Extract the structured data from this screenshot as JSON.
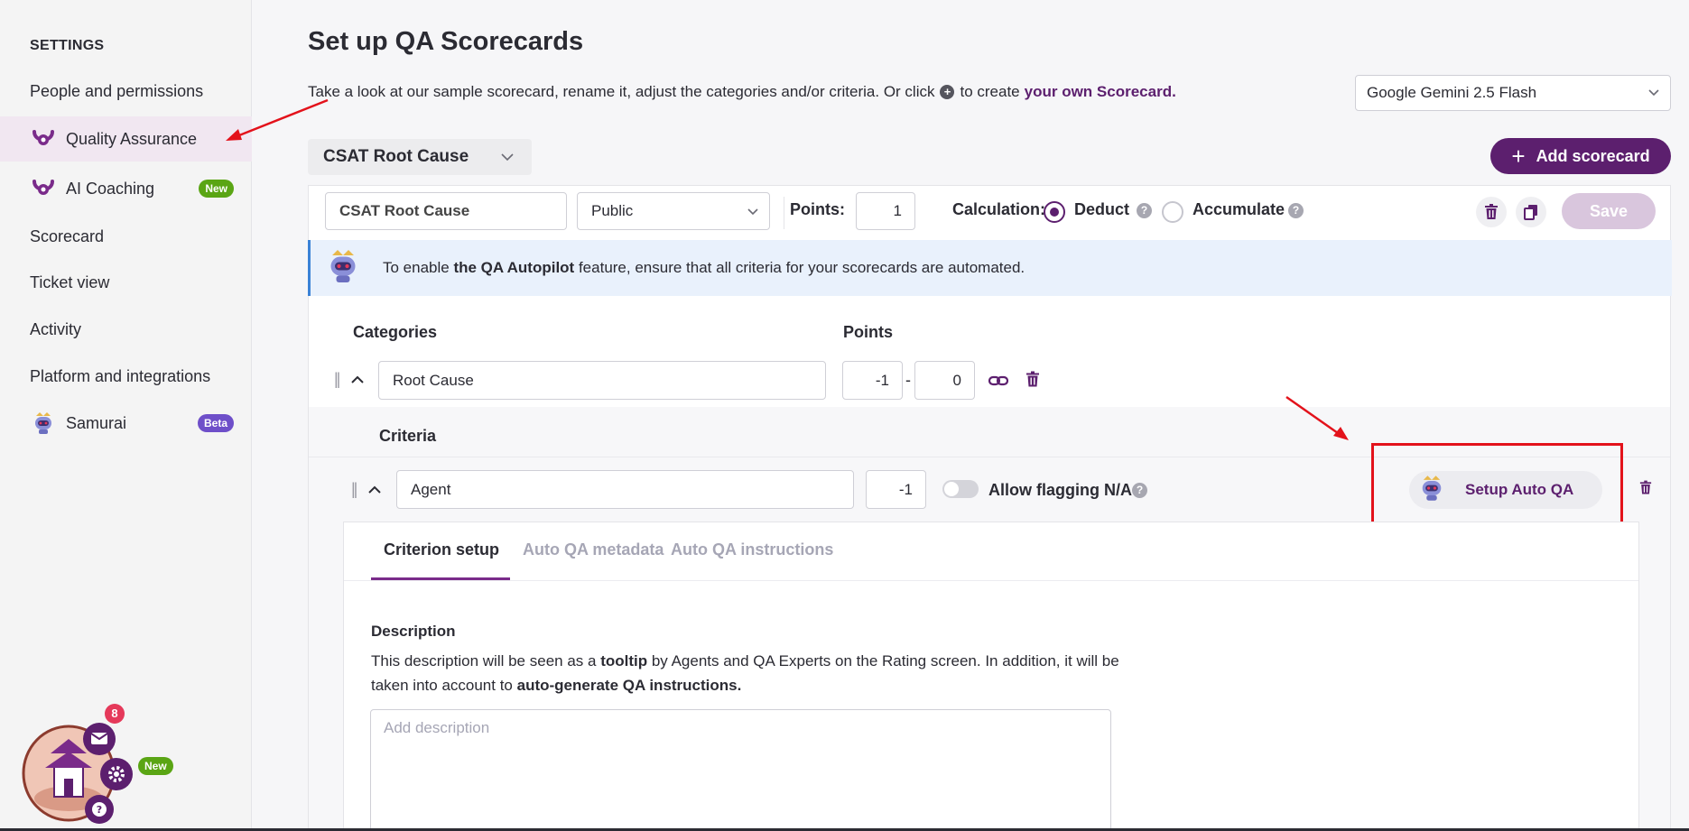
{
  "sidebar": {
    "heading": "SETTINGS",
    "items": [
      {
        "label": "People and permissions",
        "icon": ""
      },
      {
        "label": "Quality Assurance",
        "icon": "qa-logo-icon",
        "active": true
      },
      {
        "label": "AI Coaching",
        "icon": "qa-logo-icon",
        "badge": "New"
      },
      {
        "label": "Scorecard"
      },
      {
        "label": "Ticket view"
      },
      {
        "label": "Activity"
      },
      {
        "label": "Platform and integrations"
      },
      {
        "label": "Samurai",
        "icon": "samurai-bot-icon",
        "badge": "Beta"
      }
    ]
  },
  "header": {
    "title": "Set up QA Scorecards",
    "subtitle_pre": "Take a look at our sample scorecard, rename it, adjust the categories and/or criteria. Or click",
    "subtitle_mid": "to create",
    "subtitle_link": "your own Scorecard.",
    "model": "Google Gemini 2.5 Flash"
  },
  "scorecard": {
    "selected": "CSAT Root Cause",
    "add_label": "Add scorecard",
    "name": "CSAT Root Cause",
    "visibility": "Public",
    "points_label": "Points:",
    "points": "1",
    "calc_label": "Calculation:",
    "calc_options": [
      "Deduct",
      "Accumulate"
    ],
    "calc_selected": "Deduct",
    "save_label": "Save"
  },
  "banner": {
    "pre": "To enable ",
    "bold": "the QA Autopilot",
    "post": " feature, ensure that all criteria for your scorecards are automated."
  },
  "categories": {
    "header_categories": "Categories",
    "header_points": "Points",
    "rows": [
      {
        "name": "Root Cause",
        "min": "-1",
        "max": "0"
      }
    ]
  },
  "criteria": {
    "label": "Criteria",
    "rows": [
      {
        "name": "Agent",
        "points": "-1",
        "allow_na_label": "Allow flagging N/A",
        "setup_label": "Setup Auto QA"
      }
    ]
  },
  "criterion_panel": {
    "tabs": [
      "Criterion setup",
      "Auto QA metadata",
      "Auto QA instructions"
    ],
    "active_tab": "Criterion setup",
    "desc_title": "Description",
    "desc_1": "This description will be seen as a ",
    "desc_b1": "tooltip",
    "desc_2": " by Agents and QA Experts on the Rating screen. In addition, it will be taken into account to ",
    "desc_b2": "auto-generate QA instructions.",
    "desc_placeholder": "Add description"
  },
  "widget": {
    "notifications": "8",
    "badge": "New"
  },
  "colors": {
    "brand": "#5c1f6e",
    "annotation": "#e3121b",
    "info_banner": "#e9f1fc"
  }
}
